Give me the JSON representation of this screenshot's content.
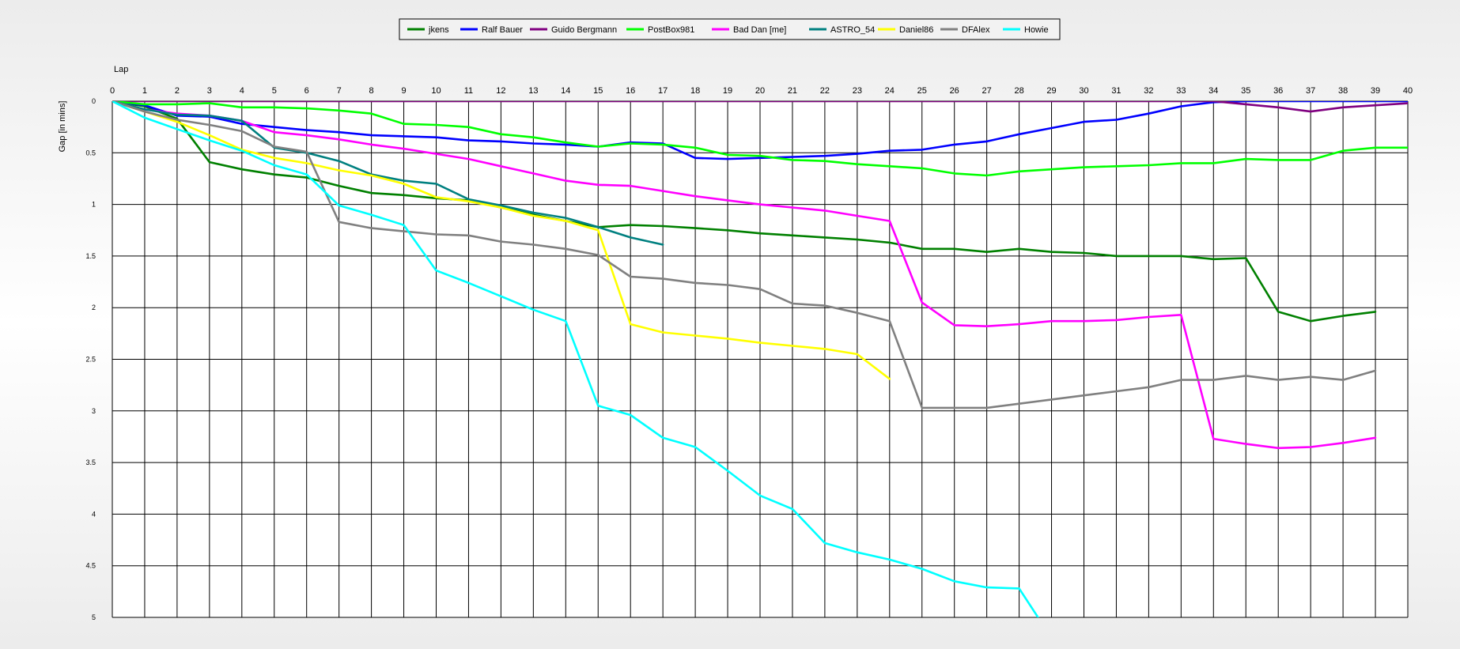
{
  "chart_data": {
    "type": "line",
    "xlabel": "Lap",
    "ylabel": "Gap [in mins]",
    "xlim": [
      0,
      40
    ],
    "ylim": [
      0,
      5
    ],
    "y_inverted": true,
    "grid": true,
    "legend_position": "top-center",
    "x": [
      0,
      1,
      2,
      3,
      4,
      5,
      6,
      7,
      8,
      9,
      10,
      11,
      12,
      13,
      14,
      15,
      16,
      17,
      18,
      19,
      20,
      21,
      22,
      23,
      24,
      25,
      26,
      27,
      28,
      29,
      30,
      31,
      32,
      33,
      34,
      35,
      36,
      37,
      38,
      39,
      40
    ],
    "x_ticks": [
      "0",
      "1",
      "2",
      "3",
      "4",
      "5",
      "6",
      "7",
      "8",
      "9",
      "10",
      "11",
      "12",
      "13",
      "14",
      "15",
      "16",
      "17",
      "18",
      "19",
      "20",
      "21",
      "22",
      "23",
      "24",
      "25",
      "26",
      "27",
      "28",
      "29",
      "30",
      "31",
      "32",
      "33",
      "34",
      "35",
      "36",
      "37",
      "38",
      "39",
      "40"
    ],
    "y_ticks": [
      "0",
      "0.5",
      "1",
      "1.5",
      "2",
      "2.5",
      "3",
      "3.5",
      "4",
      "4.5",
      "5"
    ],
    "series": [
      {
        "name": "jkens",
        "color": "#008000",
        "values": [
          0,
          0.05,
          0.17,
          0.59,
          0.66,
          0.71,
          0.74,
          0.82,
          0.89,
          0.91,
          0.94,
          0.96,
          1.03,
          1.1,
          1.16,
          1.22,
          1.2,
          1.21,
          1.23,
          1.25,
          1.28,
          1.3,
          1.32,
          1.34,
          1.37,
          1.43,
          1.43,
          1.46,
          1.43,
          1.46,
          1.47,
          1.5,
          1.5,
          1.5,
          1.53,
          1.52,
          2.04,
          2.13,
          2.08,
          2.04
        ]
      },
      {
        "name": "Ralf Bauer",
        "color": "#0000ff",
        "values": [
          0,
          0.04,
          0.14,
          0.15,
          0.22,
          0.25,
          0.28,
          0.3,
          0.33,
          0.34,
          0.35,
          0.38,
          0.39,
          0.41,
          0.42,
          0.44,
          0.4,
          0.41,
          0.55,
          0.56,
          0.55,
          0.54,
          0.53,
          0.51,
          0.48,
          0.47,
          0.42,
          0.39,
          0.32,
          0.26,
          0.2,
          0.18,
          0.12,
          0.05,
          0.01,
          0,
          0,
          0,
          0,
          0,
          0
        ]
      },
      {
        "name": "Guido Bergmann",
        "color": "#800080",
        "values": [
          0,
          0,
          0,
          0,
          0,
          0,
          0,
          0,
          0,
          0,
          0,
          0,
          0,
          0,
          0,
          0,
          0,
          0,
          0,
          0,
          0,
          0,
          0,
          0,
          0,
          0,
          0,
          0,
          0,
          0,
          0,
          0,
          0,
          0,
          0,
          0.03,
          0.06,
          0.1,
          0.06,
          0.04,
          0.02
        ]
      },
      {
        "name": "PostBox981",
        "color": "#00ff00",
        "values": [
          0,
          0.03,
          0.03,
          0.02,
          0.06,
          0.06,
          0.07,
          0.09,
          0.12,
          0.22,
          0.23,
          0.25,
          0.32,
          0.35,
          0.4,
          0.44,
          0.41,
          0.42,
          0.45,
          0.52,
          0.53,
          0.57,
          0.58,
          0.61,
          0.63,
          0.65,
          0.7,
          0.72,
          0.68,
          0.66,
          0.64,
          0.63,
          0.62,
          0.6,
          0.6,
          0.56,
          0.57,
          0.57,
          0.48,
          0.45,
          0.45
        ]
      },
      {
        "name": "Bad Dan [me]",
        "color": "#ff00ff",
        "values": [
          0,
          0.08,
          0.12,
          0.14,
          0.19,
          0.3,
          0.33,
          0.37,
          0.42,
          0.46,
          0.51,
          0.56,
          0.63,
          0.7,
          0.77,
          0.81,
          0.82,
          0.87,
          0.92,
          0.96,
          1,
          1.03,
          1.06,
          1.11,
          1.16,
          1.95,
          2.17,
          2.18,
          2.16,
          2.13,
          2.13,
          2.12,
          2.09,
          2.07,
          3.27,
          3.32,
          3.36,
          3.35,
          3.31,
          3.26
        ]
      },
      {
        "name": "ASTRO_54",
        "color": "#008080",
        "values": [
          0,
          0.08,
          0.13,
          0.14,
          0.19,
          0.45,
          0.5,
          0.58,
          0.71,
          0.77,
          0.8,
          0.95,
          1.01,
          1.08,
          1.13,
          1.22,
          1.32,
          1.39
        ]
      },
      {
        "name": "Daniel86",
        "color": "#ffff00",
        "values": [
          0,
          0.1,
          0.2,
          0.33,
          0.47,
          0.55,
          0.6,
          0.67,
          0.72,
          0.8,
          0.93,
          0.97,
          1.03,
          1.11,
          1.16,
          1.25,
          2.16,
          2.24,
          2.27,
          2.3,
          2.34,
          2.37,
          2.4,
          2.45,
          2.69
        ]
      },
      {
        "name": "DFAlex",
        "color": "#808080",
        "values": [
          0,
          0.1,
          0.18,
          0.23,
          0.29,
          0.44,
          0.49,
          1.17,
          1.23,
          1.26,
          1.29,
          1.3,
          1.36,
          1.39,
          1.43,
          1.49,
          1.7,
          1.72,
          1.76,
          1.78,
          1.82,
          1.96,
          1.98,
          2.05,
          2.13,
          2.97,
          2.97,
          2.97,
          2.93,
          2.89,
          2.85,
          2.81,
          2.77,
          2.7,
          2.7,
          2.66,
          2.7,
          2.67,
          2.7,
          2.61
        ]
      },
      {
        "name": "Howie",
        "color": "#00ffff",
        "values": [
          0,
          0.16,
          0.27,
          0.38,
          0.48,
          0.62,
          0.71,
          1.01,
          1.1,
          1.2,
          1.64,
          1.76,
          1.89,
          2.02,
          2.13,
          2.95,
          3.04,
          3.26,
          3.35,
          3.58,
          3.82,
          3.95,
          4.28,
          4.37,
          4.44,
          4.53,
          4.65,
          4.71,
          4.72,
          5.2
        ]
      }
    ]
  }
}
